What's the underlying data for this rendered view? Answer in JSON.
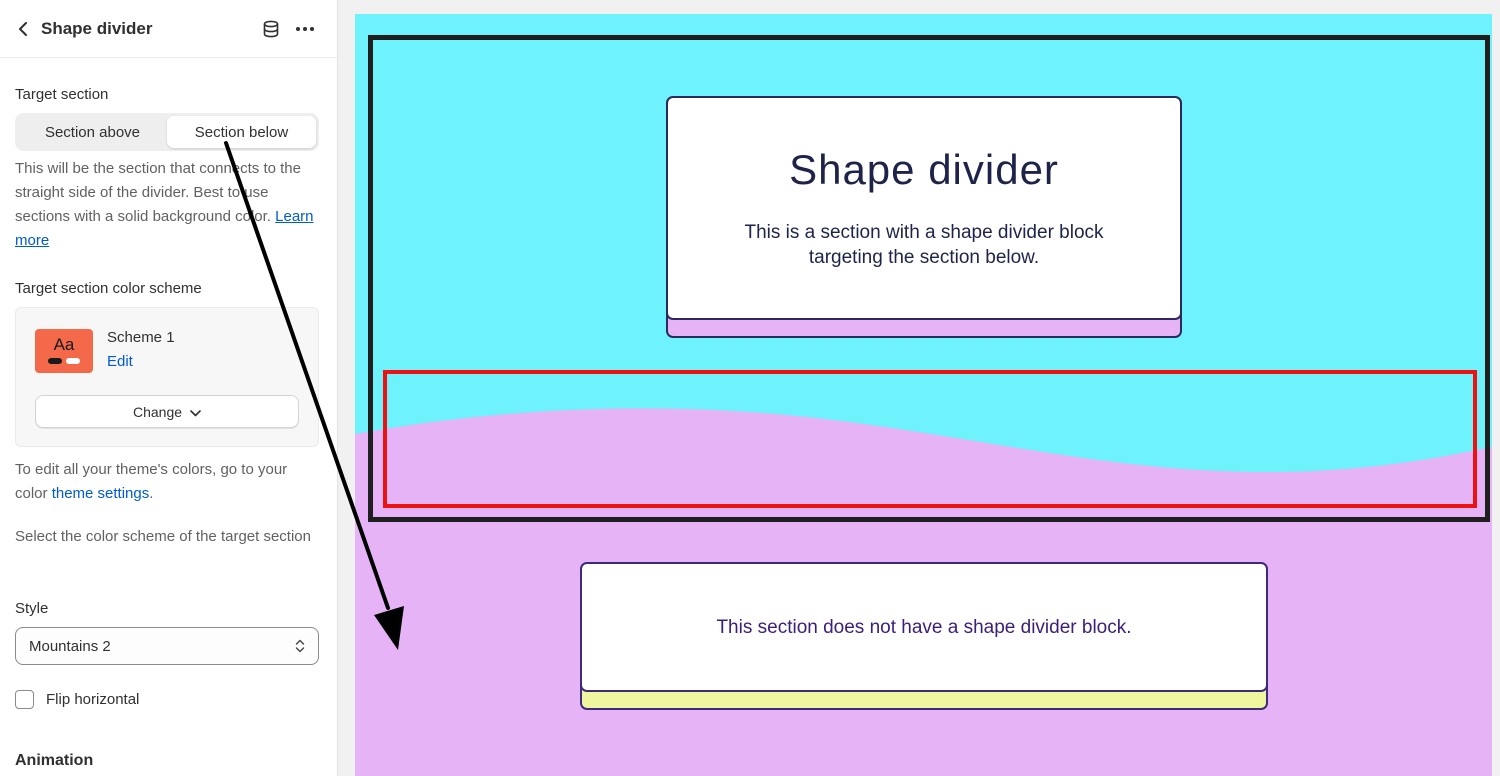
{
  "header": {
    "title": "Shape divider",
    "icons": [
      "chevron-left-icon",
      "database-icon",
      "more-horizontal-icon"
    ]
  },
  "target_section": {
    "label": "Target section",
    "options": [
      "Section above",
      "Section below"
    ],
    "selected": "Section below",
    "help_text": "This will be the section that connects to the straight side of the divider. Best to use sections with a solid background color.",
    "learn_more": "Learn more"
  },
  "color_scheme": {
    "label": "Target section color scheme",
    "swatch_text": "Aa",
    "name": "Scheme 1",
    "edit_label": "Edit",
    "change_label": "Change",
    "help_prefix": "To edit all your theme's colors, go to your color ",
    "help_link": "theme settings",
    "help_suffix": ".",
    "select_help": "Select the color scheme of the target section"
  },
  "style": {
    "label": "Style",
    "value": "Mountains 2"
  },
  "flip": {
    "label": "Flip horizontal",
    "checked": false
  },
  "animation": {
    "heading": "Animation"
  },
  "preview": {
    "section1_title": "Shape divider",
    "section1_text": "This is a section with a shape divider block targeting the section below.",
    "section2_text": "This section does not have a shape divider block.",
    "colors": {
      "top_bg": "#6ef2fb",
      "bottom_bg": "#e6b4f6",
      "accent_yellow": "#eef79e",
      "text_navy": "#1e2349",
      "highlight_red": "#ee1111"
    }
  }
}
